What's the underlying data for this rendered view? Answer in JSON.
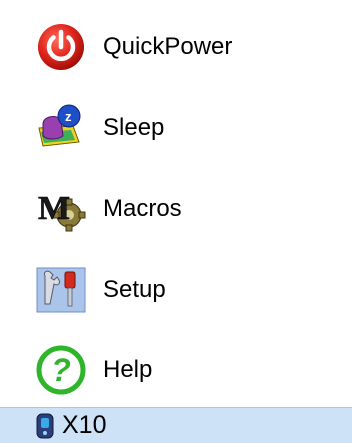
{
  "menu": {
    "items": [
      {
        "id": "quickpower",
        "label": "QuickPower",
        "icon": "power-icon"
      },
      {
        "id": "sleep",
        "label": "Sleep",
        "icon": "sleep-icon"
      },
      {
        "id": "macros",
        "label": "Macros",
        "icon": "macros-icon"
      },
      {
        "id": "setup",
        "label": "Setup",
        "icon": "setup-icon"
      },
      {
        "id": "help",
        "label": "Help",
        "icon": "help-icon"
      }
    ]
  },
  "status_bar": {
    "label": "X10",
    "icon": "x10-remote-icon"
  },
  "colors": {
    "power_red": "#e0251b",
    "help_green": "#2fb52a",
    "status_bg": "#cde1f7",
    "setup_bg": "#aac4ea"
  }
}
